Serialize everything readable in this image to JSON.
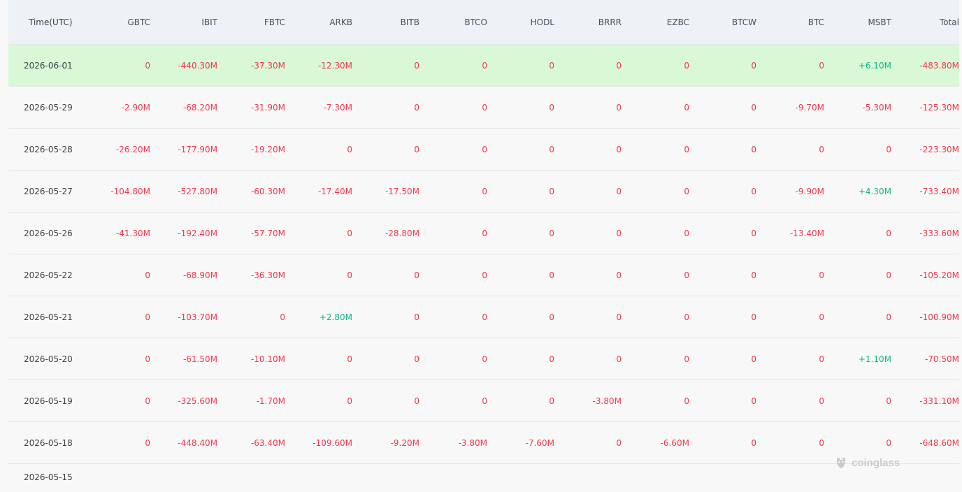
{
  "columns": [
    "Time(UTC)",
    "GBTC",
    "IBIT",
    "FBTC",
    "ARKB",
    "BITB",
    "BTCO",
    "HODL",
    "BRRR",
    "EZBC",
    "BTCW",
    "BTC",
    "MSBT",
    "Total"
  ],
  "rows": [
    {
      "date": "2026-06-01",
      "values": [
        "0",
        "-440.30M",
        "-37.30M",
        "-12.30M",
        "0",
        "0",
        "0",
        "0",
        "0",
        "0",
        "0",
        "+6.10M",
        "-483.80M"
      ]
    },
    {
      "date": "2026-05-29",
      "values": [
        "-2.90M",
        "-68.20M",
        "-31.90M",
        "-7.30M",
        "0",
        "0",
        "0",
        "0",
        "0",
        "0",
        "-9.70M",
        "-5.30M",
        "-125.30M"
      ]
    },
    {
      "date": "2026-05-28",
      "values": [
        "-26.20M",
        "-177.90M",
        "-19.20M",
        "0",
        "0",
        "0",
        "0",
        "0",
        "0",
        "0",
        "0",
        "0",
        "-223.30M"
      ]
    },
    {
      "date": "2026-05-27",
      "values": [
        "-104.80M",
        "-527.80M",
        "-60.30M",
        "-17.40M",
        "-17.50M",
        "0",
        "0",
        "0",
        "0",
        "0",
        "-9.90M",
        "+4.30M",
        "-733.40M"
      ]
    },
    {
      "date": "2026-05-26",
      "values": [
        "-41.30M",
        "-192.40M",
        "-57.70M",
        "0",
        "-28.80M",
        "0",
        "0",
        "0",
        "0",
        "0",
        "-13.40M",
        "0",
        "-333.60M"
      ]
    },
    {
      "date": "2026-05-22",
      "values": [
        "0",
        "-68.90M",
        "-36.30M",
        "0",
        "0",
        "0",
        "0",
        "0",
        "0",
        "0",
        "0",
        "0",
        "-105.20M"
      ]
    },
    {
      "date": "2026-05-21",
      "values": [
        "0",
        "-103.70M",
        "0",
        "+2.80M",
        "0",
        "0",
        "0",
        "0",
        "0",
        "0",
        "0",
        "0",
        "-100.90M"
      ]
    },
    {
      "date": "2026-05-20",
      "values": [
        "0",
        "-61.50M",
        "-10.10M",
        "0",
        "0",
        "0",
        "0",
        "0",
        "0",
        "0",
        "0",
        "+1.10M",
        "-70.50M"
      ]
    },
    {
      "date": "2026-05-19",
      "values": [
        "0",
        "-325.60M",
        "-1.70M",
        "0",
        "0",
        "0",
        "0",
        "-3.80M",
        "0",
        "0",
        "0",
        "0",
        "-331.10M"
      ]
    },
    {
      "date": "2026-05-18",
      "values": [
        "0",
        "-448.40M",
        "-63.40M",
        "-109.60M",
        "-9.20M",
        "-3.80M",
        "-7.60M",
        "0",
        "-6.60M",
        "0",
        "0",
        "0",
        "-648.60M"
      ]
    },
    {
      "date": "2026-05-15",
      "values": []
    }
  ],
  "watermark": "coinglass",
  "colors": {
    "negative": "#f0384d",
    "positive": "#16b286",
    "highlight": "#d9f8d6",
    "header_bg": "#eef1f5"
  }
}
